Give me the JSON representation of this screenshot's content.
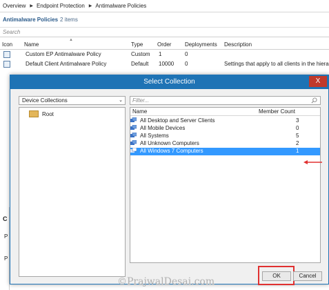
{
  "breadcrumb": {
    "items": [
      "Overview",
      "Endpoint Protection",
      "Antimalware Policies"
    ]
  },
  "list": {
    "title": "Antimalware Policies",
    "count": "2 items",
    "search_placeholder": "Search",
    "columns": [
      "Icon",
      "Name",
      "Type",
      "Order",
      "Deployments",
      "Description"
    ],
    "rows": [
      {
        "name": "Custom EP Antimalware Policy",
        "type": "Custom",
        "order": "1",
        "deployments": "0",
        "description": ""
      },
      {
        "name": "Default Client Antimalware Policy",
        "type": "Default",
        "order": "10000",
        "deployments": "0",
        "description": "Settings that apply to all clients in the hiera"
      }
    ]
  },
  "left_strip": {
    "c": "C",
    "p1": "P",
    "p2": "P"
  },
  "dialog": {
    "title": "Select Collection",
    "close_label": "X",
    "collection_type": "Device Collections",
    "tree": {
      "root_label": "Root"
    },
    "filter_placeholder": "Filter...",
    "list_columns": [
      "Name",
      "Member Count"
    ],
    "collections": [
      {
        "name": "All Desktop and Server Clients",
        "count": "3"
      },
      {
        "name": "All Mobile Devices",
        "count": "0"
      },
      {
        "name": "All Systems",
        "count": "5"
      },
      {
        "name": "All Unknown Computers",
        "count": "2"
      },
      {
        "name": "All Windows 7 Computers",
        "count": "1"
      }
    ],
    "ok_label": "OK",
    "cancel_label": "Cancel"
  },
  "watermark": "©PrajwalDesai.com",
  "colors": {
    "titlebar": "#1e73b5",
    "selection": "#3399ff",
    "highlight": "#e03030",
    "close": "#c0392b"
  }
}
